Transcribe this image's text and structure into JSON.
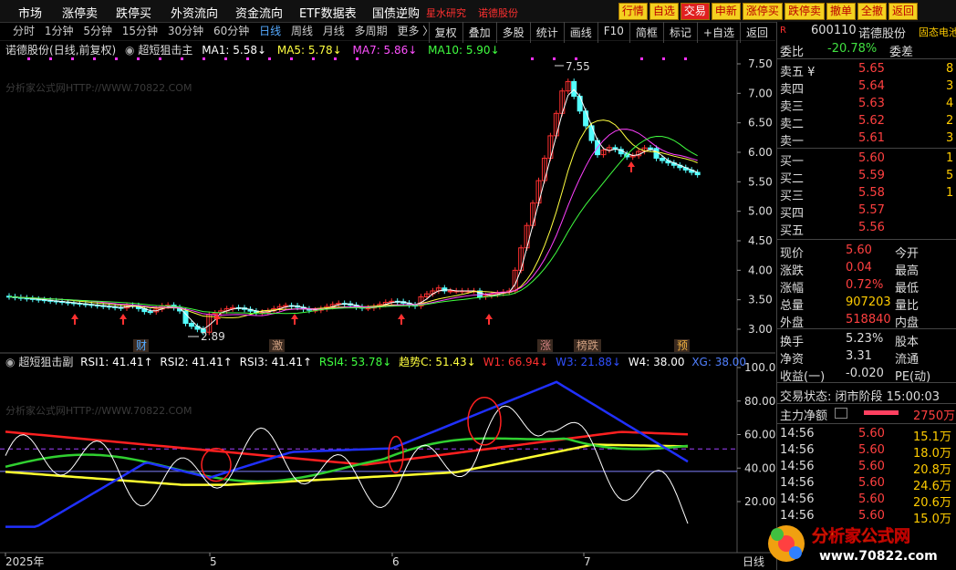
{
  "menu": {
    "items": [
      "市场",
      "涨停卖",
      "跌停买",
      "外资流向",
      "资金流向",
      "ETF数据表",
      "国债逆购"
    ],
    "hot": [
      "星水研究",
      "诺德股份"
    ],
    "right_buttons": [
      "行情",
      "自选",
      "交易",
      "申新",
      "涨停买",
      "跌停卖",
      "撤单",
      "全撤",
      "返回"
    ]
  },
  "toolbar": {
    "items": [
      "复权",
      "叠加",
      "多股",
      "统计",
      "画线",
      "F10",
      "简框",
      "标记",
      "+自选",
      "返回"
    ]
  },
  "stock": {
    "name": "诺德股份",
    "mode": "(日线,前复权)",
    "indicator": "超短狙击主",
    "ma1": "MA1: 5.58↓",
    "ma5": "MA5: 5.78↓",
    "ma7": "MA7: 5.86↓",
    "ma10": "MA10: 5.90↓"
  },
  "periods": [
    "分时",
    "1分钟",
    "5分钟",
    "15分钟",
    "30分钟",
    "60分钟",
    "日线",
    "周线",
    "月线",
    "多周期",
    "更多 〉"
  ],
  "sub": {
    "name": "超短狙击副",
    "rsi1": "RSI1: 41.41↑",
    "rsi2": "RSI2: 41.41↑",
    "rsi3": "RSI3: 41.41↑",
    "rsi4": "RSI4: 53.78↓",
    "trend": "趋势C: 51.43↓",
    "w1": "W1: 66.94↓",
    "w3": "W3: 21.88↓",
    "w4": "W4: 38.00",
    "xg": "XG: 38.00"
  },
  "watermark": "分析家公式网HTTP://WWW.70822.COM",
  "price_axis": [
    "7.50",
    "7.00",
    "6.50",
    "6.00",
    "5.50",
    "5.00",
    "4.50",
    "4.00",
    "3.50",
    "3.00"
  ],
  "sub_axis": [
    "100.0",
    "80.00",
    "60.00",
    "40.00",
    "20.00"
  ],
  "annotations": {
    "high": "7.55",
    "low": "2.89"
  },
  "markers": [
    "财",
    "激",
    "涨",
    "榜跌",
    "预"
  ],
  "date_axis": [
    "2025年",
    "5",
    "6",
    "7"
  ],
  "date_tag": "日线",
  "panel": {
    "code": "600110",
    "name": "诺德股份",
    "tag": "固态电池",
    "weibi_label": "委比",
    "weibi": "-20.78%",
    "weicha_label": "委差",
    "sell": [
      {
        "label": "卖五 ¥",
        "price": "5.65",
        "vol": "8"
      },
      {
        "label": "卖四",
        "price": "5.64",
        "vol": "3"
      },
      {
        "label": "卖三",
        "price": "5.63",
        "vol": "4"
      },
      {
        "label": "卖二",
        "price": "5.62",
        "vol": "2"
      },
      {
        "label": "卖一",
        "price": "5.61",
        "vol": "3"
      }
    ],
    "buy": [
      {
        "label": "买一",
        "price": "5.60",
        "vol": "1"
      },
      {
        "label": "买二",
        "price": "5.59",
        "vol": "5"
      },
      {
        "label": "买三",
        "price": "5.58",
        "vol": "1"
      },
      {
        "label": "买四",
        "price": "5.57",
        "vol": ""
      },
      {
        "label": "买五",
        "price": "5.56",
        "vol": ""
      }
    ],
    "quote": [
      {
        "l": "现价",
        "v": "5.60",
        "r": "今开"
      },
      {
        "l": "涨跌",
        "v": "0.04",
        "r": "最高"
      },
      {
        "l": "涨幅",
        "v": "0.72%",
        "r": "最低"
      },
      {
        "l": "总量",
        "v": "907203",
        "r": "量比"
      },
      {
        "l": "外盘",
        "v": "518840",
        "r": "内盘"
      }
    ],
    "stats": [
      {
        "l": "换手",
        "v": "5.23%",
        "r": "股本"
      },
      {
        "l": "净资",
        "v": "3.31",
        "r": "流通"
      },
      {
        "l": "收益(一)",
        "v": "-0.020",
        "r": "PE(动)"
      }
    ],
    "status": "交易状态: 闭市阶段 15:00:03",
    "netflow_label": "主力净额",
    "netflow": "2750万",
    "ticks": [
      {
        "t": "14:56",
        "p": "5.60",
        "v": "15.1万"
      },
      {
        "t": "14:56",
        "p": "5.60",
        "v": "18.0万"
      },
      {
        "t": "14:56",
        "p": "5.60",
        "v": "20.8万"
      },
      {
        "t": "14:56",
        "p": "5.60",
        "v": "24.6万"
      },
      {
        "t": "14:56",
        "p": "5.60",
        "v": "20.6万"
      },
      {
        "t": "14:56",
        "p": "5.60",
        "v": "15.0万"
      }
    ]
  },
  "logo": {
    "text": "分析家公式网",
    "url": "www.70822.com"
  },
  "colors": {
    "up": "#ff3030",
    "down": "#54ffff",
    "ma1": "#ffffff",
    "ma5": "#ffff40",
    "ma7": "#ff40ff",
    "ma10": "#40ff40"
  }
}
